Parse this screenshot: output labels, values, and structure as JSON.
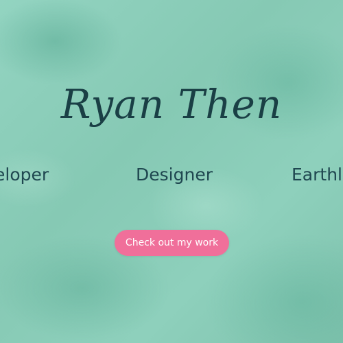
{
  "hero": {
    "name": "Ryan Then",
    "roles": [
      "eloper",
      "Designer",
      "Earthli"
    ],
    "cta_label": "Check out my work"
  },
  "colors": {
    "background": "#8ccfbb",
    "heading_text": "#1a3f45",
    "role_text": "#1f4750",
    "button_bg": "#f06f9a",
    "button_text": "#ffffff"
  }
}
